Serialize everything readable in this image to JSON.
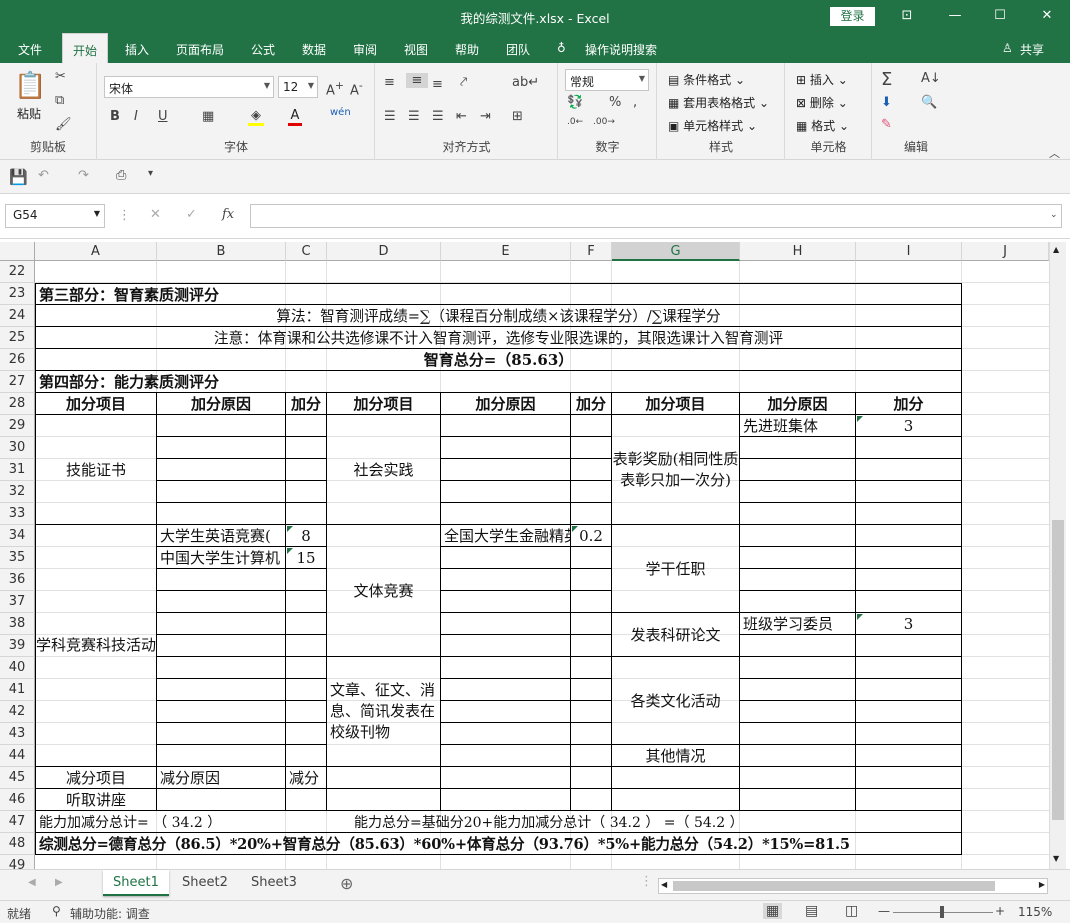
{
  "title": "我的综测文件.xlsx  -  Excel",
  "login": "登录",
  "menu": [
    "文件",
    "开始",
    "插入",
    "页面布局",
    "公式",
    "数据",
    "审阅",
    "视图",
    "帮助",
    "团队",
    "操作说明搜索"
  ],
  "share": "共享",
  "ribbon": {
    "paste": "粘贴",
    "clipboard": "剪贴板",
    "font_name": "宋体",
    "font_size": "12",
    "font_group": "字体",
    "bold": "B",
    "italic": "I",
    "underline": "U",
    "wen": "wén",
    "align_group": "对齐方式",
    "number_format": "常规",
    "number_group": "数字",
    "cond_format": "条件格式",
    "table_format": "套用表格格式",
    "cell_style": "单元格样式",
    "styles_group": "样式",
    "insert": "插入",
    "delete": "删除",
    "format": "格式",
    "cells_group": "单元格",
    "edit_group": "编辑"
  },
  "namebox": "G54",
  "fx": "fx",
  "columns": [
    "A",
    "B",
    "C",
    "D",
    "E",
    "F",
    "G",
    "H",
    "I",
    "J"
  ],
  "rows": [
    "22",
    "23",
    "24",
    "25",
    "26",
    "27",
    "28",
    "29",
    "30",
    "31",
    "32",
    "33",
    "34",
    "35",
    "36",
    "37",
    "38",
    "39",
    "40",
    "41",
    "42",
    "43",
    "44",
    "45",
    "46",
    "47",
    "48",
    "49"
  ],
  "sheet": {
    "r23": "第三部分：智育素质测评分",
    "r24": "算法：智育测评成绩=∑（课程百分制成绩×该课程学分）/∑课程学分",
    "r25": "注意：体育课和公共选修课不计入智育测评，选修专业限选课的，其限选课计入智育测评",
    "r26": "智育总分=（85.63）",
    "r27": "第四部分：能力素质测评分",
    "hdr_item": "加分项目",
    "hdr_reason": "加分原因",
    "hdr_score": "加分",
    "skill_cert": "技能证书",
    "social_practice": "社会实践",
    "honor": "表彰奖励(相同性质表彰只加一次分)",
    "honor_reason": "先进班集体",
    "honor_score": "3",
    "competition": "学科竞赛科技活动",
    "comp1": "大学生英语竞赛(",
    "comp1_score": "8",
    "comp2": "中国大学生计算机",
    "comp2_score": "15",
    "finance": "全国大学生金融精英",
    "finance_score": "0.2",
    "culture_comp": "文体竞赛",
    "cadre": "学干任职",
    "paper": "发表科研论文",
    "cadre_reason": "班级学习委员",
    "cadre_score": "3",
    "articles": "文章、征文、消息、简讯发表在校级刊物",
    "cultural": "各类文化活动",
    "other": "其他情况",
    "deduct_item": "减分项目",
    "deduct_reason": "减分原因",
    "deduct": "减分",
    "lecture": "听取讲座",
    "r47a": "能力加减分总计=  （ 34.2 ）",
    "r47b": "能力总分=基础分20+能力加减分总计（ 34.2 ） =（ 54.2 ）",
    "r48": "综测总分=德育总分（86.5）*20%+智育总分（85.63）*60%+体育总分（93.76）*5%+能力总分（54.2）*15%=81.5"
  },
  "tabs": [
    "Sheet1",
    "Sheet2",
    "Sheet3"
  ],
  "status": {
    "ready": "就绪",
    "accessibility": "辅助功能: 调查",
    "zoom": "115%"
  }
}
